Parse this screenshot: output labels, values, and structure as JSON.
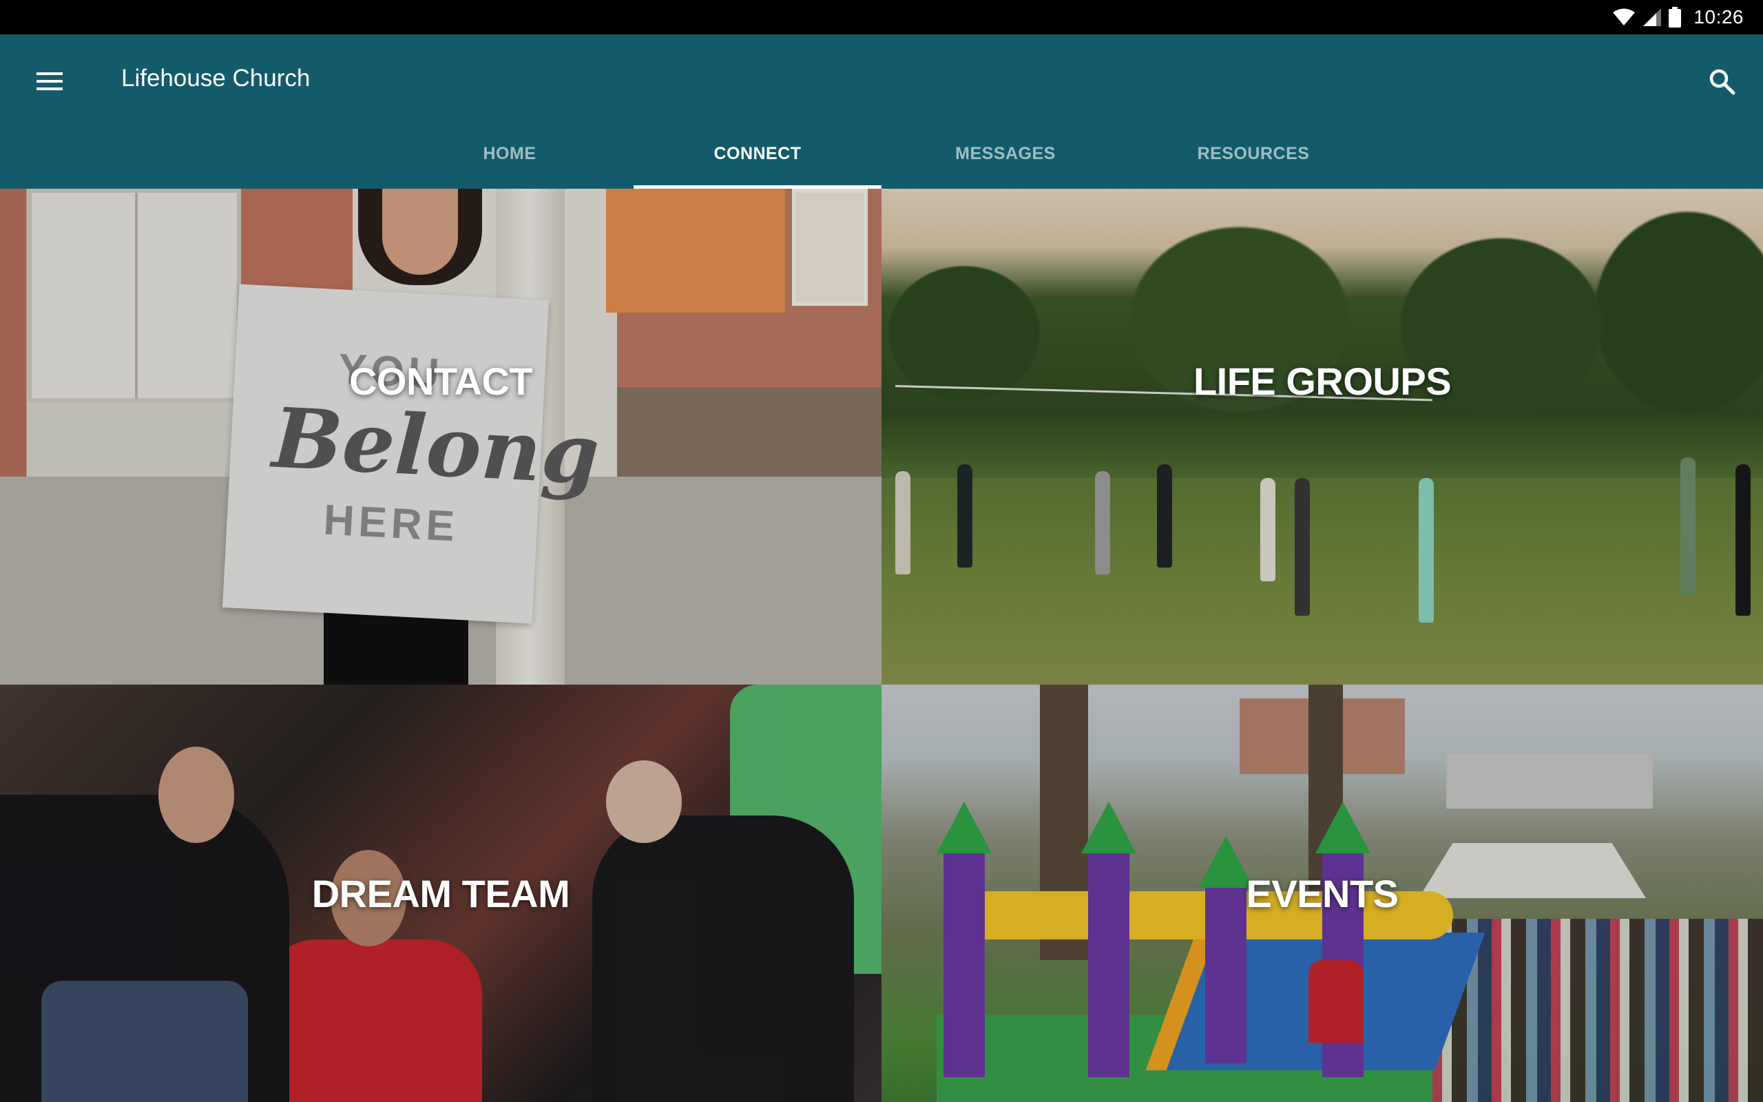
{
  "status_bar": {
    "time": "10:26",
    "icons": [
      "wifi-icon",
      "cellular-signal-icon",
      "battery-icon"
    ]
  },
  "app_bar": {
    "title": "Lifehouse Church",
    "menu_icon": "hamburger-menu-icon",
    "search_icon": "search-icon",
    "background_color": "#135b6a"
  },
  "tabs": [
    {
      "label": "HOME",
      "active": false
    },
    {
      "label": "CONNECT",
      "active": true
    },
    {
      "label": "MESSAGES",
      "active": false
    },
    {
      "label": "RESOURCES",
      "active": false
    }
  ],
  "tiles": [
    {
      "label": "CONTACT",
      "image": "woman holding 'You Belong Here' sign"
    },
    {
      "label": "LIFE GROUPS",
      "image": "people playing volleyball in a park"
    },
    {
      "label": "DREAM TEAM",
      "image": "group of volunteers talking"
    },
    {
      "label": "EVENTS",
      "image": "bounce house at outdoor event"
    }
  ],
  "contact_sign": {
    "line1": "YOU",
    "line2": "Belong",
    "line3": "HERE"
  }
}
